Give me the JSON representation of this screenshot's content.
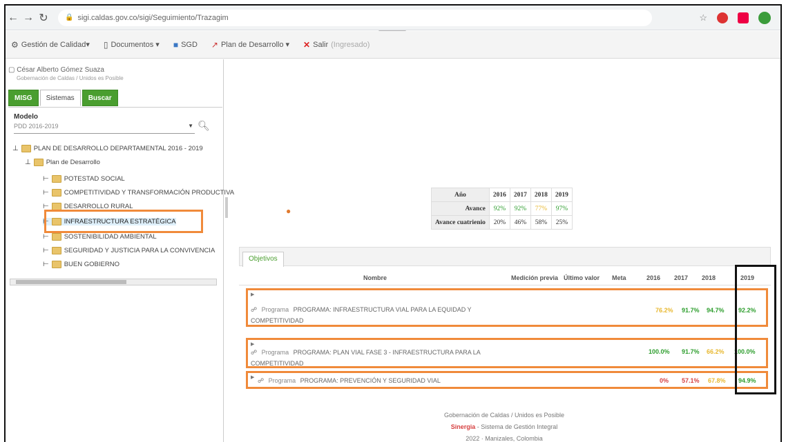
{
  "browser": {
    "url": "sigi.caldas.gov.co/sigi/Seguimiento/Trazagim"
  },
  "toolbar": {
    "items": [
      {
        "label": "Gestión de Calidad▾"
      },
      {
        "label": "Documentos ▾"
      },
      {
        "label": "SGD"
      },
      {
        "label": "Plan de Desarrollo ▾"
      },
      {
        "label": "Salir"
      }
    ],
    "salir_extra": "(Ingresado)"
  },
  "left": {
    "user_name": "César Alberto Gómez Suaza",
    "user_sub": "Gobernación de Caldas / Unidos es Posible",
    "tabs": [
      "MISG",
      "Sistemas",
      "Buscar"
    ],
    "modelo_label": "Modelo",
    "modelo_value": "PDD 2016-2019",
    "tree": {
      "root": "PLAN DE DESARROLLO DEPARTAMENTAL 2016 - 2019",
      "plan": "Plan de Desarrollo",
      "items": [
        "POTESTAD SOCIAL",
        "COMPETITIVIDAD Y TRANSFORMACIÓN PRODUCTIVA",
        "DESARROLLO RURAL",
        "INFRAESTRUCTURA ESTRATÉGICA",
        "SOSTENIBILIDAD AMBIENTAL",
        "SEGURIDAD Y JUSTICIA PARA LA CONVIVENCIA",
        "BUEN GOBIERNO"
      ]
    }
  },
  "year_table": {
    "label_year": "Año",
    "years": [
      "2016",
      "2017",
      "2018",
      "2019"
    ],
    "avance_label": "Avance",
    "avance": [
      "92%",
      "92%",
      "77%",
      "97%"
    ],
    "cuatrienio_label": "Avance cuatrienio",
    "cuatrienio": [
      "20%",
      "46%",
      "58%",
      "25%"
    ]
  },
  "objetivos": {
    "tab": "Objetivos",
    "columns": [
      "Nombre",
      "Medición previa",
      "Último valor",
      "Meta",
      "2016",
      "2017",
      "2018",
      "2019"
    ],
    "rows": [
      {
        "prefix": "Programa",
        "name": "PROGRAMA: INFRAESTRUCTURA VIAL PARA LA EQUIDAD Y COMPETITIVIDAD",
        "v2016": "76.2%",
        "v2017": "91.7%",
        "v2018": "94.7%",
        "v2019": "92.2%"
      },
      {
        "prefix": "Programa",
        "name": "PROGRAMA: PLAN VIAL FASE 3 - INFRAESTRUCTURA PARA LA COMPETITIVIDAD",
        "v2016": "100.0%",
        "v2017": "91.7%",
        "v2018": "66.2%",
        "v2019": "100.0%"
      },
      {
        "prefix": "Programa",
        "name": "PROGRAMA: PREVENCIÓN Y SEGURIDAD VIAL",
        "v2016": "0%",
        "v2017": "57.1%",
        "v2018": "67.8%",
        "v2019": "94.9%"
      }
    ]
  },
  "footer": {
    "line1": "Gobernación de Caldas / Unidos es Posible",
    "sig": "Sinergia",
    "line2": "- Sistema de Gestión Integral",
    "line3": "2022 · Manizales, Colombia"
  }
}
